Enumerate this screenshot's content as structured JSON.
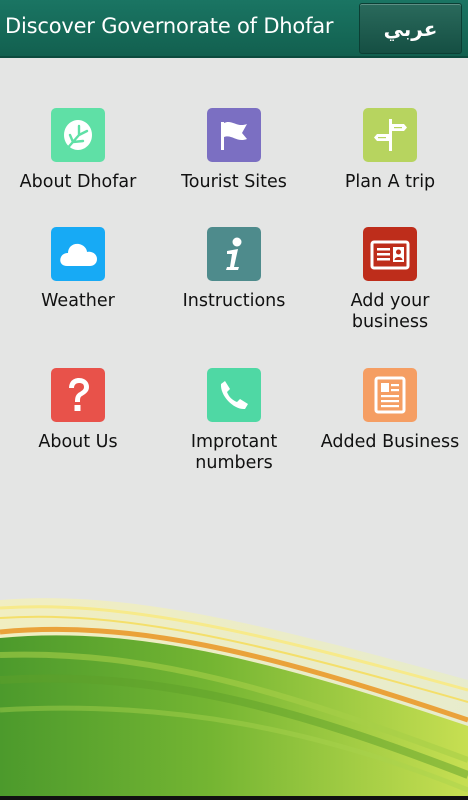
{
  "header": {
    "title": "Discover Governorate of Dhofar",
    "language_button": "عربي"
  },
  "menu": [
    {
      "label": "About Dhofar",
      "icon": "leaf-icon",
      "color": "#5fe0a6"
    },
    {
      "label": "Tourist Sites",
      "icon": "flag-icon",
      "color": "#7b6fc2"
    },
    {
      "label": "Plan A trip",
      "icon": "signpost-icon",
      "color": "#b7d45f"
    },
    {
      "label": "Weather",
      "icon": "cloud-icon",
      "color": "#17aaf5"
    },
    {
      "label": "Instructions",
      "icon": "info-icon",
      "color": "#4e8b8c"
    },
    {
      "label": "Add your\nbusiness",
      "icon": "id-card-icon",
      "color": "#be2d1b"
    },
    {
      "label": "About Us",
      "icon": "question-icon",
      "color": "#e8524a"
    },
    {
      "label": "Improtant\nnumbers",
      "icon": "phone-icon",
      "color": "#4fd8a4"
    },
    {
      "label": "Added Business",
      "icon": "document-icon",
      "color": "#f59e63"
    }
  ]
}
